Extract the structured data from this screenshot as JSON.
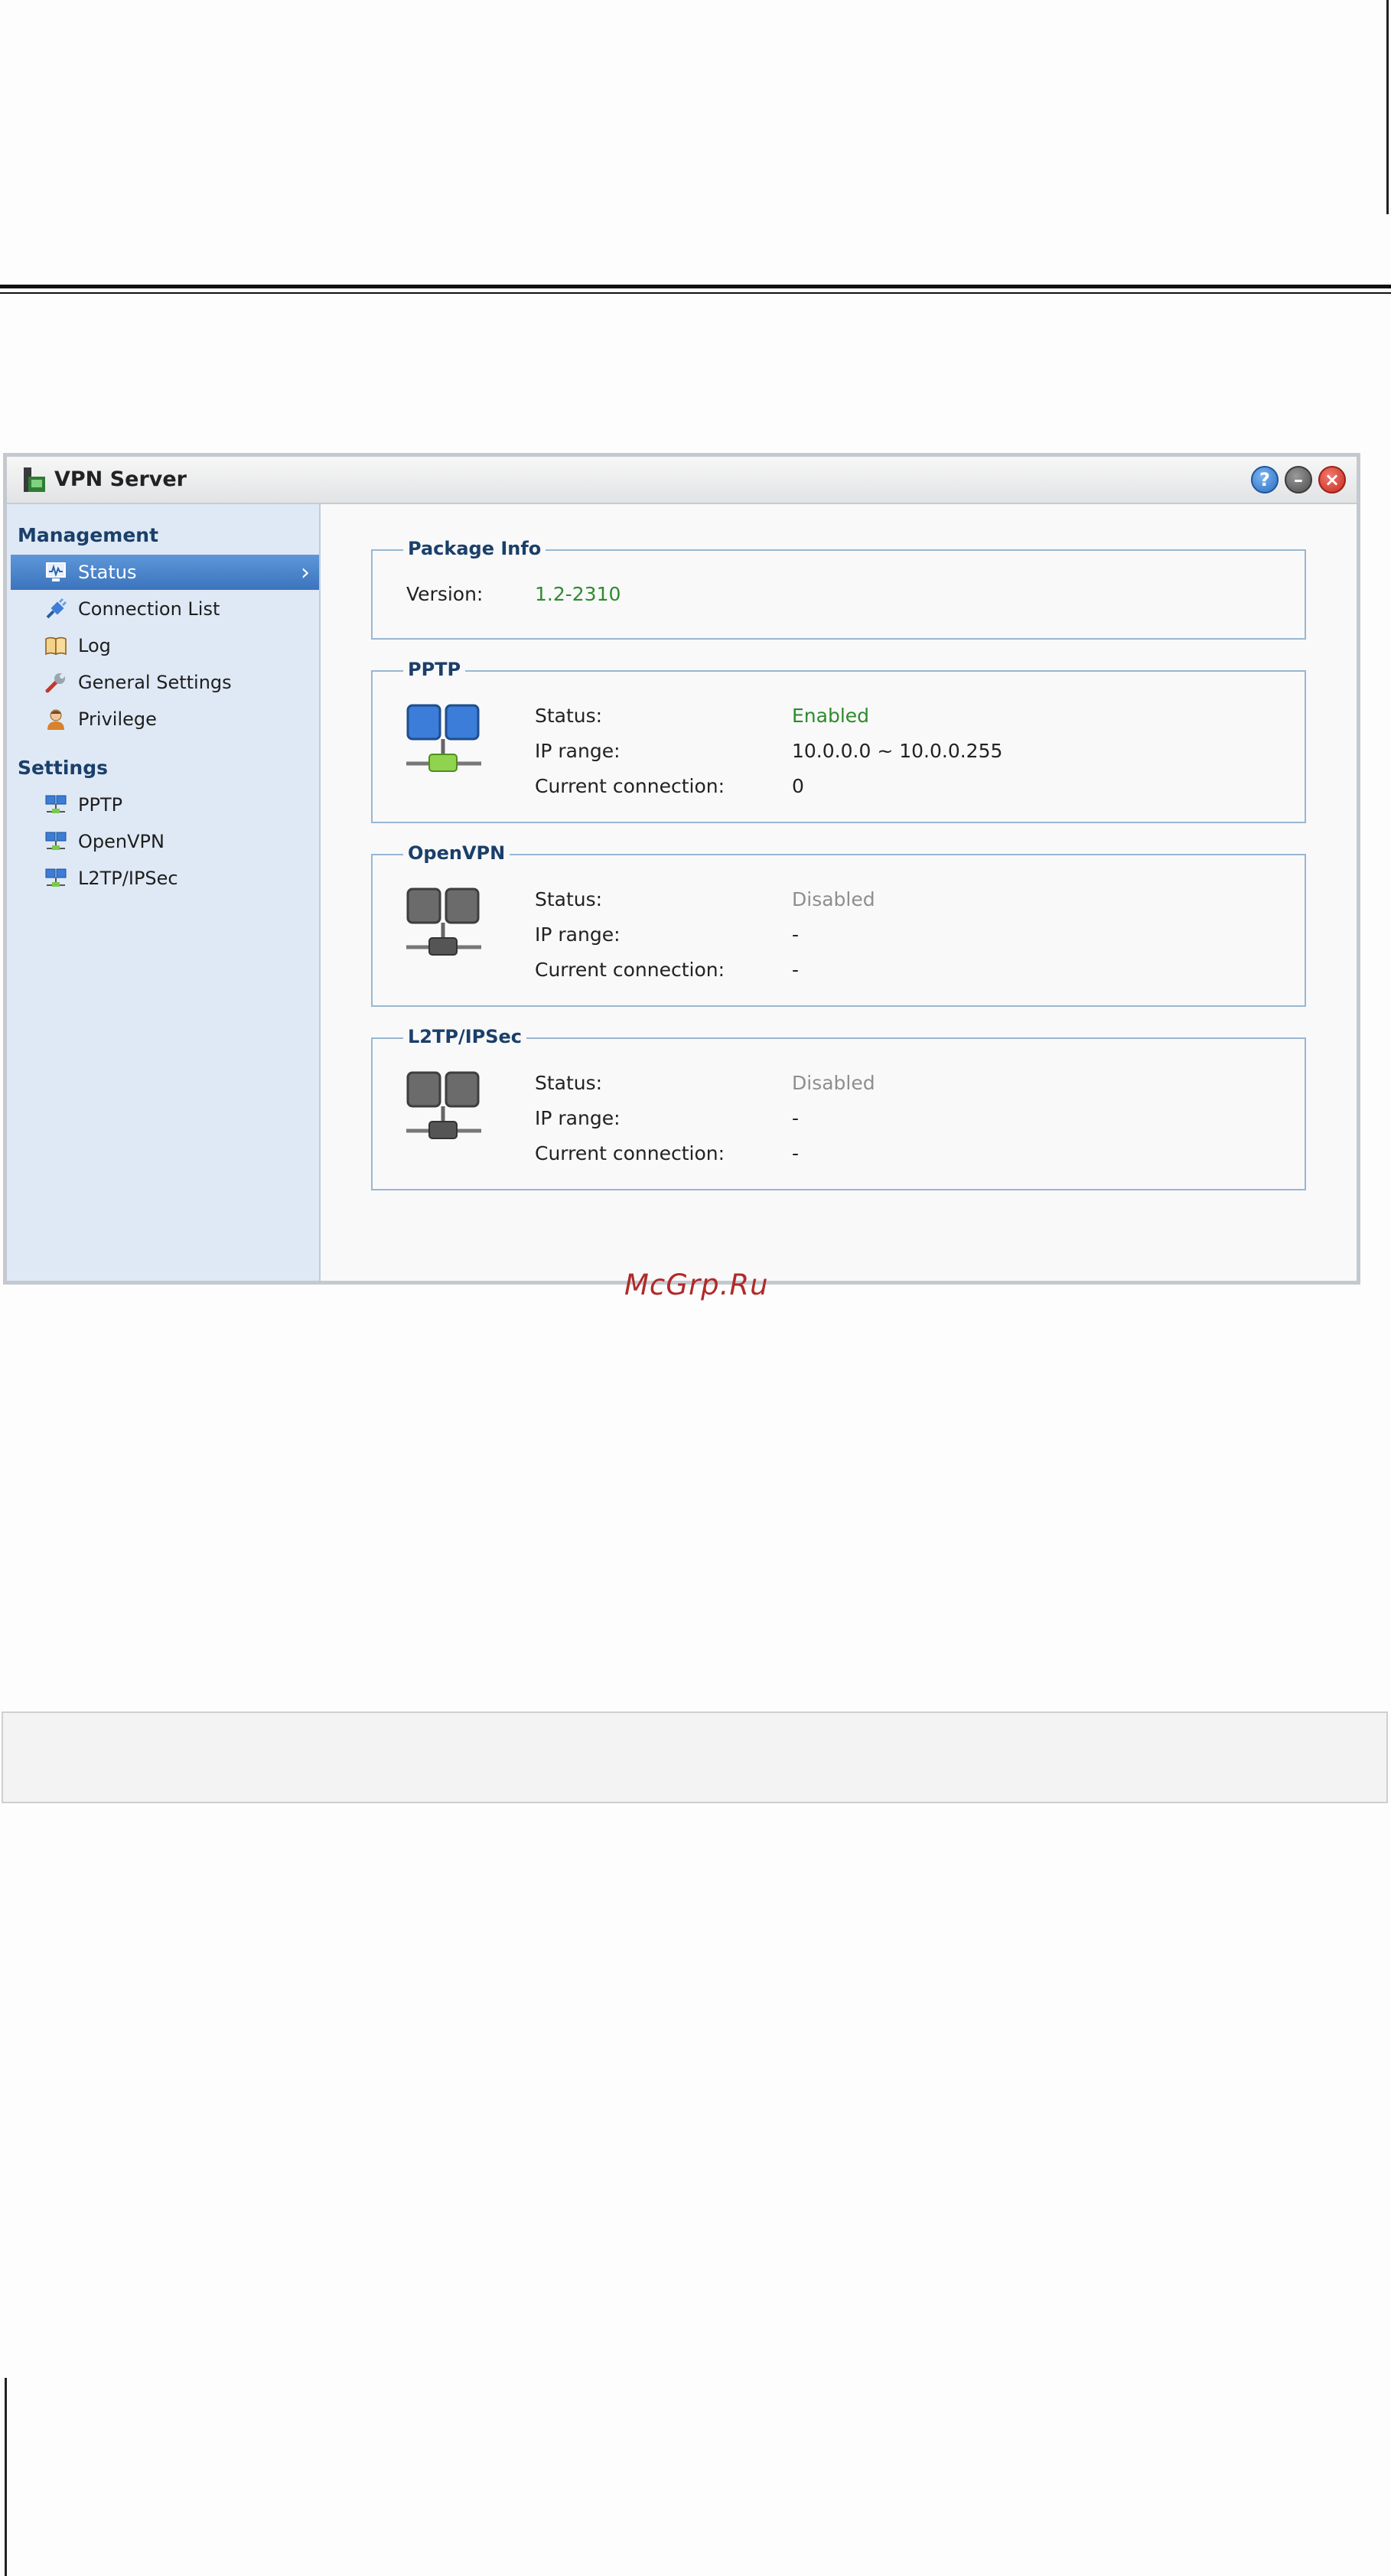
{
  "window": {
    "title": "VPN Server"
  },
  "titlebar_buttons": {
    "help": "?",
    "minimize": "–",
    "close": "×"
  },
  "sidebar": {
    "management_heading": "Management",
    "management_items": [
      {
        "label": "Status",
        "icon": "monitor-icon",
        "active": true
      },
      {
        "label": "Connection List",
        "icon": "plug-icon"
      },
      {
        "label": "Log",
        "icon": "book-icon"
      },
      {
        "label": "General Settings",
        "icon": "wrench-icon"
      },
      {
        "label": "Privilege",
        "icon": "user-icon"
      }
    ],
    "settings_heading": "Settings",
    "settings_items": [
      {
        "label": "PPTP",
        "icon": "network-icon"
      },
      {
        "label": "OpenVPN",
        "icon": "network-icon"
      },
      {
        "label": "L2TP/IPSec",
        "icon": "network-icon"
      }
    ]
  },
  "package_info": {
    "title": "Package Info",
    "version_label": "Version:",
    "version_value": "1.2-2310"
  },
  "services": [
    {
      "title": "PPTP",
      "status_label": "Status:",
      "status_value": "Enabled",
      "ip_label": "IP range:",
      "ip_value": "10.0.0.0 ~ 10.0.0.255",
      "conn_label": "Current connection:",
      "conn_value": "0",
      "enabled": true
    },
    {
      "title": "OpenVPN",
      "status_label": "Status:",
      "status_value": "Disabled",
      "ip_label": "IP range:",
      "ip_value": "-",
      "conn_label": "Current connection:",
      "conn_value": "-",
      "enabled": false
    },
    {
      "title": "L2TP/IPSec",
      "status_label": "Status:",
      "status_value": "Disabled",
      "ip_label": "IP range:",
      "ip_value": "-",
      "conn_label": "Current connection:",
      "conn_value": "-",
      "enabled": false
    }
  ],
  "watermark": "McGrp.Ru",
  "colors": {
    "accent": "#3c74bd",
    "enabled": "#2e8b2e",
    "disabled": "#8e8e8e",
    "sidebar_bg": "#dfe9f5"
  }
}
